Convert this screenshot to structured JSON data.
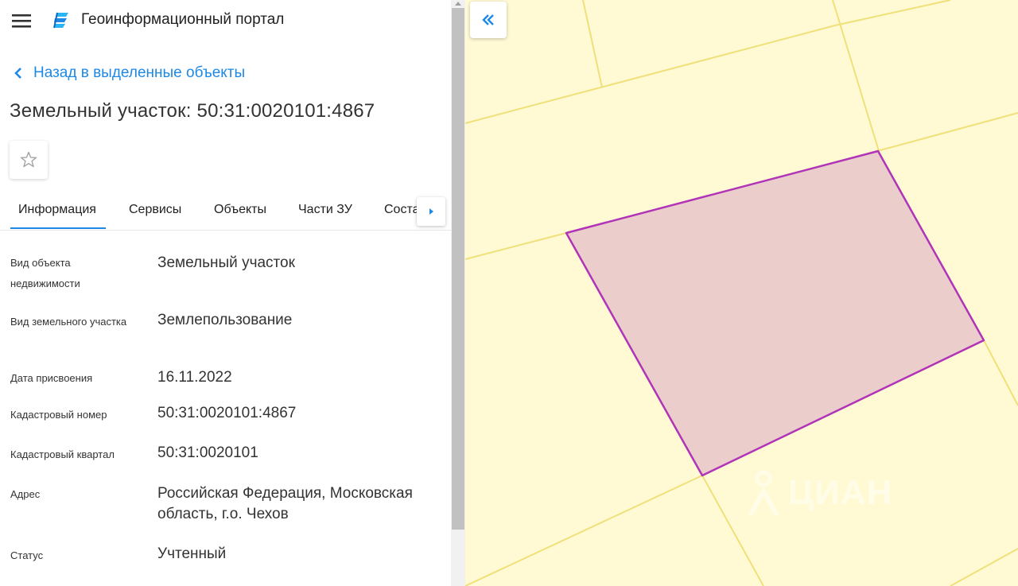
{
  "header": {
    "app_title": "Геоинформационный портал"
  },
  "nav": {
    "back_label": "Назад в выделенные объекты"
  },
  "object": {
    "title": "Земельный участок: 50:31:0020101:4867"
  },
  "tabs": [
    {
      "label": "Информация",
      "active": true
    },
    {
      "label": "Сервисы"
    },
    {
      "label": "Объекты"
    },
    {
      "label": "Части ЗУ"
    },
    {
      "label": "Соста"
    }
  ],
  "properties": [
    {
      "label": "Вид объекта недвижимости",
      "value": "Земельный участок"
    },
    {
      "label": "Вид земельного участка",
      "value": "Землепользование"
    },
    {
      "label": "Дата присвоения",
      "value": "16.11.2022"
    },
    {
      "label": "Кадастровый номер",
      "value": "50:31:0020101:4867"
    },
    {
      "label": "Кадастровый квартал",
      "value": "50:31:0020101"
    },
    {
      "label": "Адрес",
      "value": "Российская Федерация, Московская область, г.о. Чехов"
    },
    {
      "label": "Статус",
      "value": "Учтенный"
    }
  ],
  "map": {
    "watermark": "ЦИАН"
  },
  "colors": {
    "accent": "#1e88e5",
    "map_background": "#fffad4",
    "parcel_lines": "#f0e07a",
    "selected_fill": "#ebcdcb",
    "selected_stroke": "#b033b8"
  },
  "icons": {
    "menu": "menu-icon",
    "logo": "logo-icon",
    "back": "chevron-left-icon",
    "favorite": "star-outline-icon",
    "tab_scroll": "caret-right-icon",
    "collapse": "double-chevron-left-icon"
  }
}
